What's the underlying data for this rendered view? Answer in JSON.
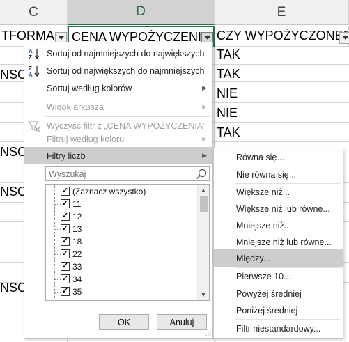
{
  "columns": {
    "c_letter": "C",
    "d_letter": "D",
    "e_letter": "E"
  },
  "headers": {
    "c": "TFORMA",
    "d": "CENA WYPOŻYCZENIA",
    "e": "CZY WYPOŻYCZONE?"
  },
  "cells": {
    "e_values": [
      "TAK",
      "TAK",
      "NIE",
      "NIE",
      "TAK"
    ],
    "c_partial": [
      "NSOI",
      "NSOI",
      "NSOI",
      "NSOI"
    ]
  },
  "menu": {
    "sort_asc": "Sortuj od najmniejszych do największych",
    "sort_desc": "Sortuj od największych do najmniejszych",
    "sort_color": "Sortuj według kolorów",
    "sheet_view": "Widok arkusza",
    "clear_filter": "Wyczyść filtr z „CENA WYPOŻYCZENIA”",
    "filter_color": "Filtruj według koloru",
    "number_filters": "Filtry liczb",
    "search_placeholder": "Wyszukaj",
    "select_all": "(Zaznacz wszystko)",
    "values": [
      "11",
      "12",
      "13",
      "18",
      "22",
      "33",
      "34",
      "35"
    ],
    "ok": "OK",
    "cancel": "Anuluj"
  },
  "submenu": {
    "items": [
      "Równa się...",
      "Nie równa się...",
      "Większe niż...",
      "Większe niż lub równe...",
      "Mniejsze niż...",
      "Mniejsze niż lub równe...",
      "Między...",
      "Pierwsze 10...",
      "Powyżej średniej",
      "Poniżej średniej",
      "Filtr niestandardowy..."
    ],
    "highlighted": "Między..."
  },
  "colors": {
    "selected_col_accent": "#217346",
    "highlight": "#cdcdcd",
    "sort_icon_blue": "#2b5797"
  }
}
